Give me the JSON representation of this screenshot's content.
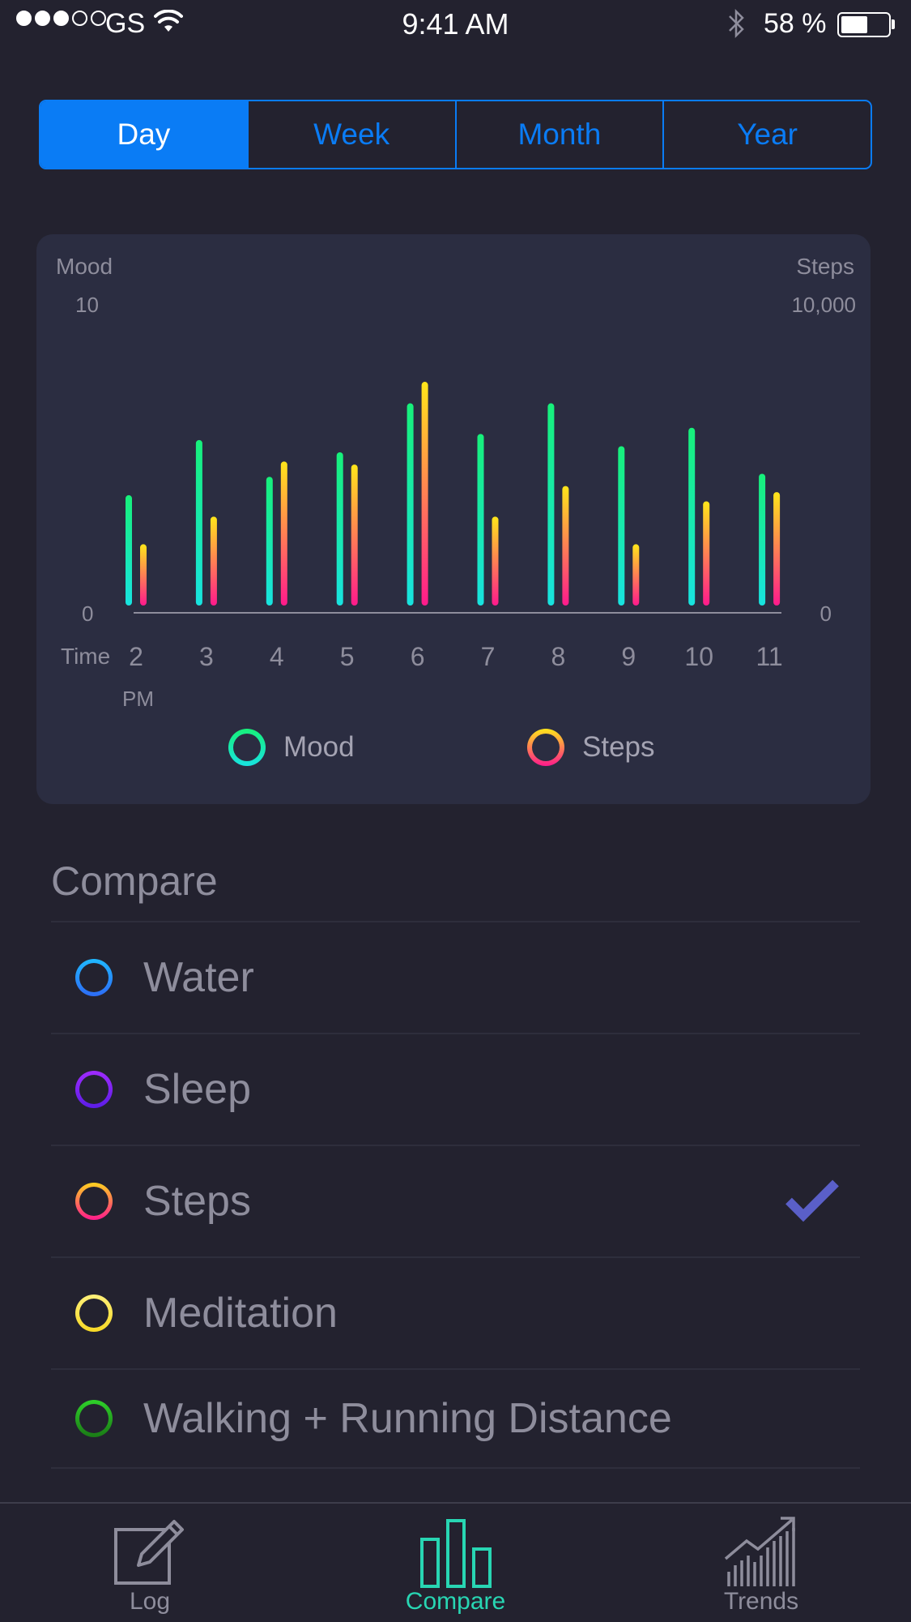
{
  "status_bar": {
    "carrier": "GS",
    "time": "9:41 AM",
    "battery_text": "58 %",
    "battery_level": 0.58
  },
  "segments": [
    {
      "label": "Day",
      "active": true
    },
    {
      "label": "Week",
      "active": false
    },
    {
      "label": "Month",
      "active": false
    },
    {
      "label": "Year",
      "active": false
    }
  ],
  "chart_data": {
    "type": "bar",
    "left_axis_label": "Mood",
    "right_axis_label": "Steps",
    "left_max_label": "10",
    "right_max_label": "10,000",
    "left_min_label": "0",
    "right_min_label": "0",
    "xlabel": "Time",
    "x_sub_label": "PM",
    "categories": [
      "2",
      "3",
      "4",
      "5",
      "6",
      "7",
      "8",
      "9",
      "10",
      "11"
    ],
    "mood_range": [
      0,
      10
    ],
    "steps_range": [
      0,
      10000
    ],
    "series": [
      {
        "name": "Mood",
        "axis": "left",
        "values": [
          3.6,
          5.4,
          4.2,
          5.0,
          6.6,
          5.6,
          6.6,
          5.2,
          5.8,
          4.3
        ]
      },
      {
        "name": "Steps",
        "axis": "right",
        "values": [
          2000,
          2900,
          4700,
          4600,
          7300,
          2900,
          3900,
          2000,
          3400,
          3700
        ]
      }
    ],
    "legend": [
      "Mood",
      "Steps"
    ],
    "grid": false
  },
  "compare": {
    "title": "Compare",
    "items": [
      {
        "label": "Water",
        "checked": false,
        "colors": [
          "#1fb8ff",
          "#2d6cf6"
        ]
      },
      {
        "label": "Sleep",
        "checked": false,
        "colors": [
          "#a02bff",
          "#5b1de6"
        ]
      },
      {
        "label": "Steps",
        "checked": true,
        "colors": [
          "#ffd21f",
          "#ff1a8c"
        ]
      },
      {
        "label": "Meditation",
        "checked": false,
        "colors": [
          "#fff07a",
          "#f7d925"
        ]
      },
      {
        "label": "Walking + Running Distance",
        "checked": false,
        "colors": [
          "#2fd12a",
          "#1a7a16"
        ]
      }
    ]
  },
  "tabs": [
    {
      "label": "Log",
      "icon": "pencil-square-icon",
      "active": false
    },
    {
      "label": "Compare",
      "icon": "bar-chart-icon",
      "active": true
    },
    {
      "label": "Trends",
      "icon": "trend-up-icon",
      "active": false
    }
  ],
  "colors": {
    "accent": "#0a7cf5",
    "mood_gradient": [
      "#17f07a",
      "#18e3e0"
    ],
    "steps_gradient": [
      "#ffe61a",
      "#ff1a8c"
    ],
    "check": "#5a5fc8",
    "tab_active": "#28d6b3"
  }
}
